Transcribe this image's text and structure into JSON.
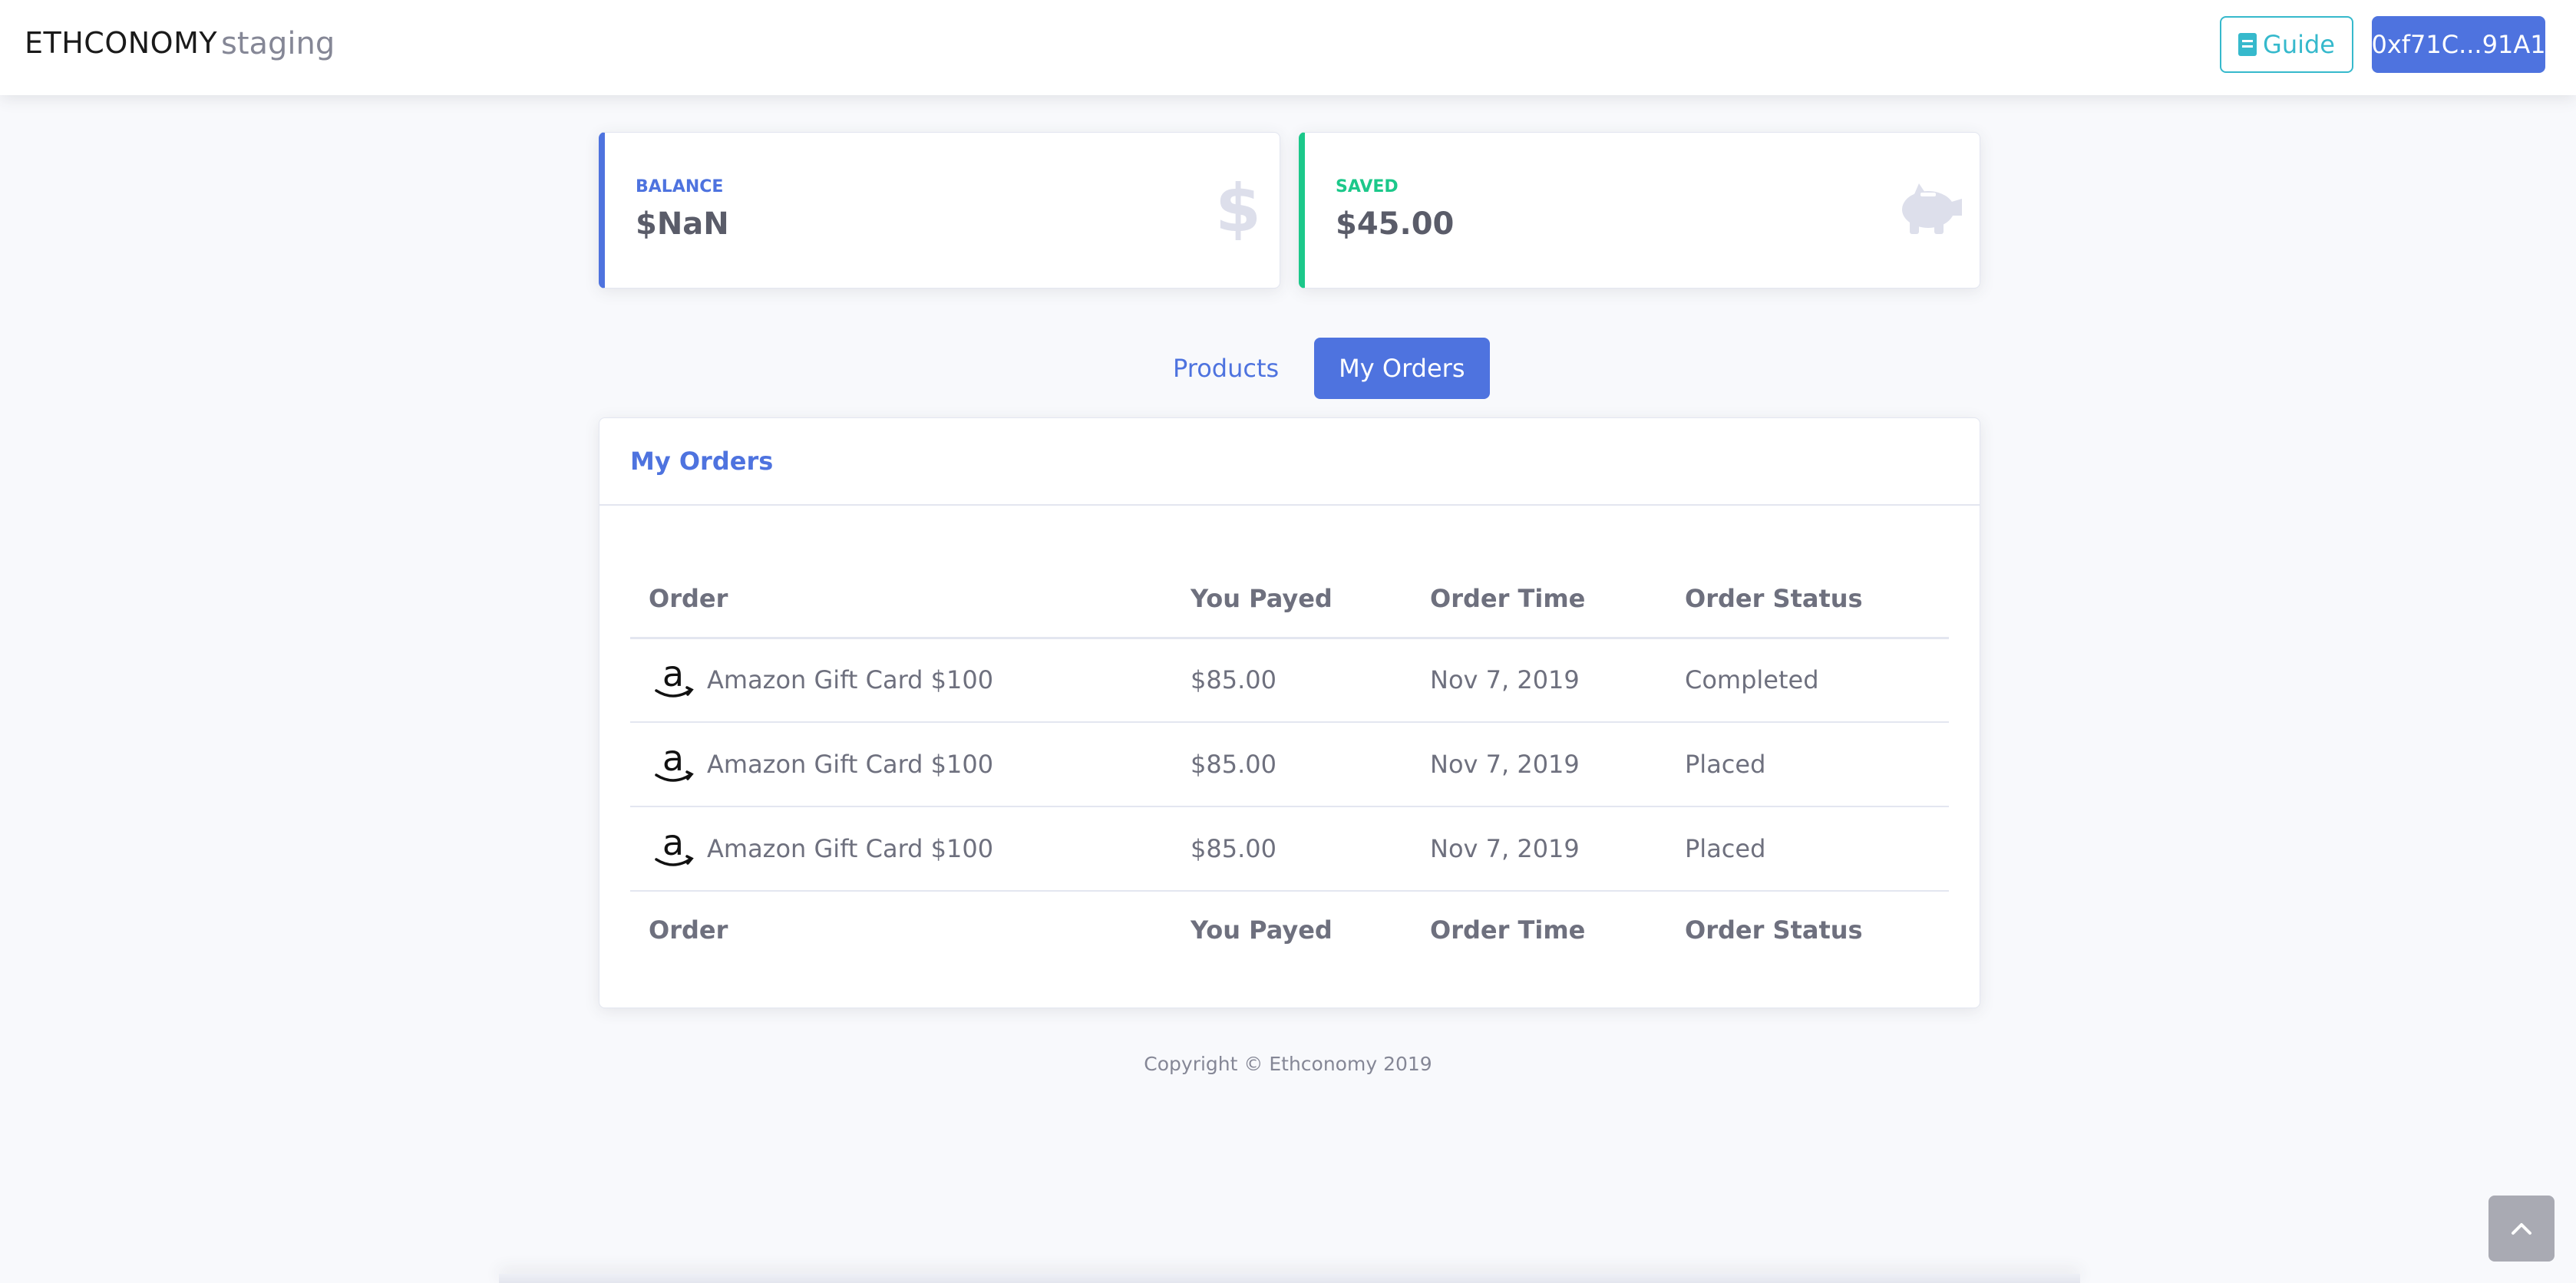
{
  "header": {
    "brand": "ETHCONOMY",
    "environment": "staging",
    "guide_label": "Guide",
    "wallet_label": "0xf71C...91A1"
  },
  "stats": {
    "balance": {
      "label": "BALANCE",
      "value": "$NaN",
      "icon": "dollar-icon",
      "color": "#4e73df"
    },
    "saved": {
      "label": "SAVED",
      "value": "$45.00",
      "icon": "piggy-bank-icon",
      "color": "#1cc88a"
    }
  },
  "tabs": [
    {
      "label": "Products",
      "active": false
    },
    {
      "label": "My Orders",
      "active": true
    }
  ],
  "orders": {
    "title": "My Orders",
    "columns": [
      "Order",
      "You Payed",
      "Order Time",
      "Order Status"
    ],
    "rows": [
      {
        "order": "Amazon Gift Card $100",
        "paid": "$85.00",
        "time": "Nov 7, 2019",
        "status": "Completed",
        "icon": "amazon-logo-icon"
      },
      {
        "order": "Amazon Gift Card $100",
        "paid": "$85.00",
        "time": "Nov 7, 2019",
        "status": "Placed",
        "icon": "amazon-logo-icon"
      },
      {
        "order": "Amazon Gift Card $100",
        "paid": "$85.00",
        "time": "Nov 7, 2019",
        "status": "Placed",
        "icon": "amazon-logo-icon"
      }
    ]
  },
  "footer": {
    "copyright": "Copyright © Ethconomy 2019"
  },
  "colors": {
    "primary": "#4e73df",
    "success": "#1cc88a",
    "info": "#36b9cc",
    "background": "#f8f9fc"
  }
}
